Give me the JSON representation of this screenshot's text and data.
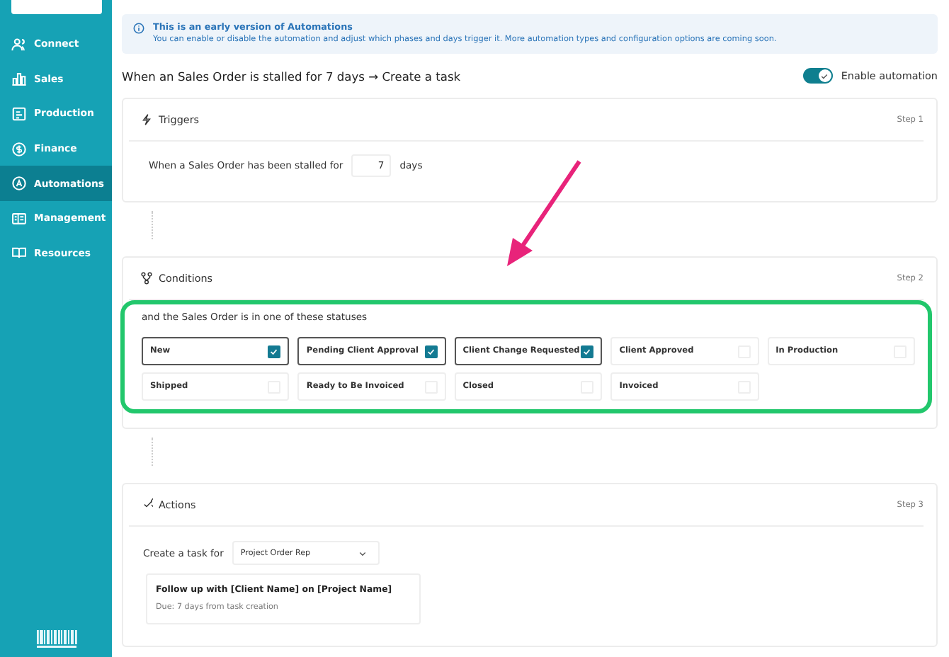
{
  "sidebar": {
    "items": [
      {
        "label": "Connect",
        "selected": false
      },
      {
        "label": "Sales",
        "selected": false
      },
      {
        "label": "Production",
        "selected": false
      },
      {
        "label": "Finance",
        "selected": false
      },
      {
        "label": "Automations",
        "selected": true
      },
      {
        "label": "Management",
        "selected": false
      },
      {
        "label": "Resources",
        "selected": false
      }
    ]
  },
  "banner": {
    "title": "This is an early version of Automations",
    "text": "You can enable or disable the automation and adjust which phases and days trigger it. More automation types and configuration options are coming soon."
  },
  "automation": {
    "title": "When an Sales Order is stalled for 7 days → Create a task",
    "toggle_label": "Enable automation",
    "enabled": true
  },
  "triggers": {
    "title": "Triggers",
    "step": "Step 1",
    "text_before": "When a Sales Order has been stalled for",
    "days_value": "7",
    "text_after": "days"
  },
  "conditions": {
    "title": "Conditions",
    "step": "Step 2",
    "prompt": "and the Sales Order is in one of these statuses",
    "statuses": [
      {
        "label": "New",
        "checked": true
      },
      {
        "label": "Pending Client Approval",
        "checked": true
      },
      {
        "label": "Client Change Requested",
        "checked": true
      },
      {
        "label": "Client Approved",
        "checked": false
      },
      {
        "label": "In Production",
        "checked": false
      },
      {
        "label": "Shipped",
        "checked": false
      },
      {
        "label": "Ready to Be Invoiced",
        "checked": false
      },
      {
        "label": "Closed",
        "checked": false
      },
      {
        "label": "Invoiced",
        "checked": false
      }
    ]
  },
  "actions": {
    "title": "Actions",
    "step": "Step 3",
    "assign_label": "Create a task for",
    "assignee": "Project Order Rep",
    "task": {
      "title": "Follow up with [Client Name] on [Project Name]",
      "due": "Due: 7 days from task creation"
    }
  }
}
